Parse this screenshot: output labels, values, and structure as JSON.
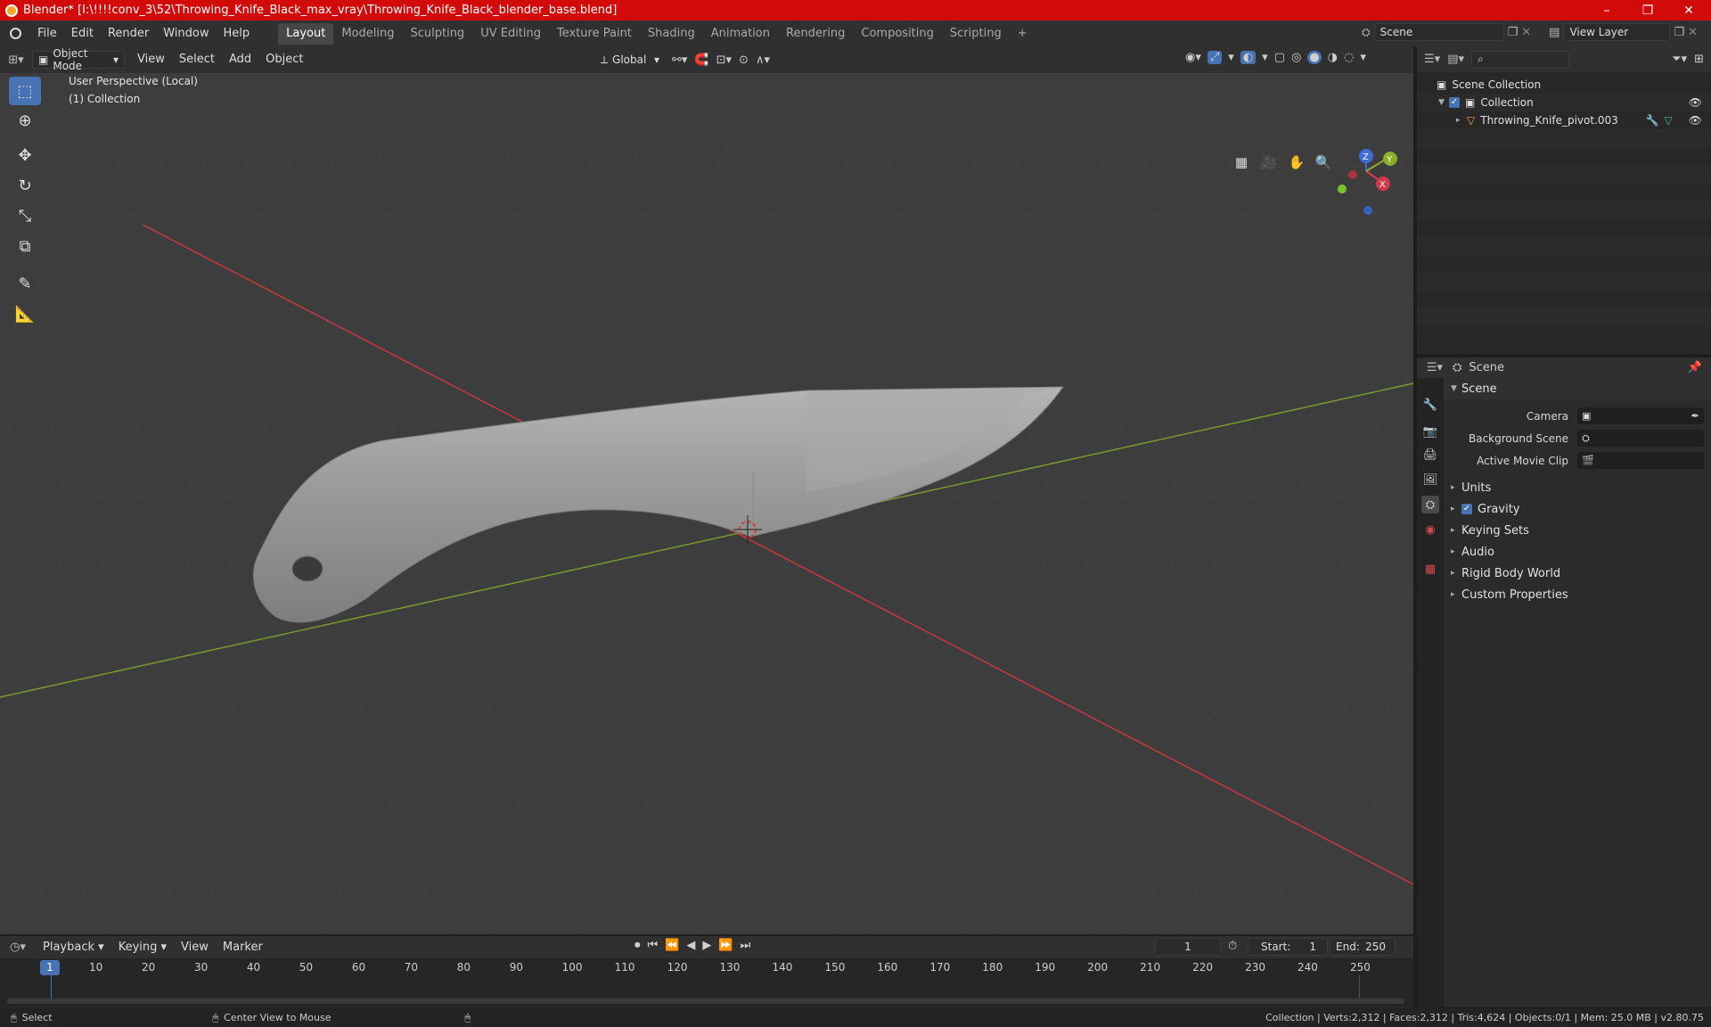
{
  "window": {
    "title": "Blender* [I:\\!!!!conv_3\\52\\Throwing_Knife_Black_max_vray\\Throwing_Knife_Black_blender_base.blend]",
    "minimize": "–",
    "maximize": "❐",
    "close": "✕"
  },
  "menu": [
    "File",
    "Edit",
    "Render",
    "Window",
    "Help"
  ],
  "workspaces": [
    "Layout",
    "Modeling",
    "Sculpting",
    "UV Editing",
    "Texture Paint",
    "Shading",
    "Animation",
    "Rendering",
    "Compositing",
    "Scripting"
  ],
  "workspace_add": "+",
  "scene_selector": {
    "value": "Scene"
  },
  "viewlayer_selector": {
    "value": "View Layer"
  },
  "viewport_header": {
    "mode": "Object Mode",
    "menus": [
      "View",
      "Select",
      "Add",
      "Object"
    ],
    "transform_orientation": "Global"
  },
  "viewport": {
    "perspective_label": "User Perspective (Local)",
    "collection_label": "(1) Collection",
    "gizmo": {
      "x": "X",
      "y": "Y",
      "z": "Z"
    }
  },
  "outliner": {
    "search_placeholder": "",
    "scene_collection": "Scene Collection",
    "collection": "Collection",
    "object": "Throwing_Knife_pivot.003"
  },
  "properties": {
    "header_title": "Scene",
    "section_scene": "Scene",
    "camera_label": "Camera",
    "background_scene_label": "Background Scene",
    "active_movie_clip_label": "Active Movie Clip",
    "sections": [
      "Units",
      "Gravity",
      "Keying Sets",
      "Audio",
      "Rigid Body World",
      "Custom Properties"
    ]
  },
  "timeline": {
    "menus": [
      "Playback",
      "Keying",
      "View",
      "Marker"
    ],
    "current_frame": "1",
    "start_label": "Start:",
    "start": "1",
    "end_label": "End:",
    "end": "250",
    "frame_numbers": [
      "1",
      "10",
      "20",
      "30",
      "40",
      "50",
      "60",
      "70",
      "80",
      "90",
      "100",
      "110",
      "120",
      "130",
      "140",
      "150",
      "160",
      "170",
      "180",
      "190",
      "200",
      "210",
      "220",
      "230",
      "240",
      "250"
    ]
  },
  "statusbar": {
    "select": "Select",
    "center_view": "Center View to Mouse",
    "stats": "Collection | Verts:2,312 | Faces:2,312 | Tris:4,624 | Objects:0/1 | Mem: 25.0 MB | v2.80.75"
  },
  "colors": {
    "title_red": "#d30a0a",
    "accent_blue": "#4772b3",
    "axis_red": "#c8383f",
    "axis_green": "#7a9a2c"
  }
}
